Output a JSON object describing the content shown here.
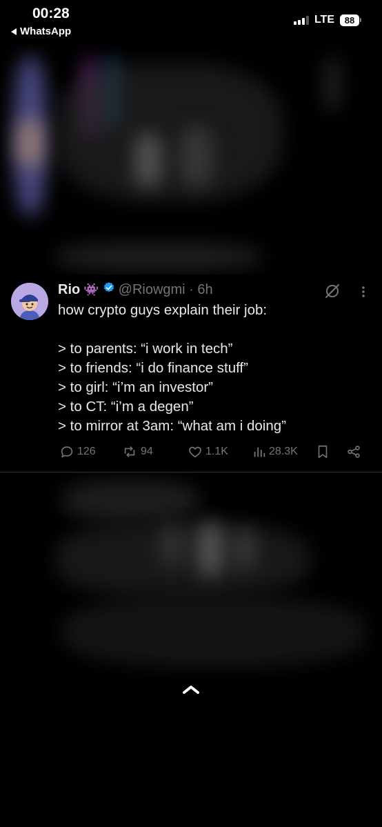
{
  "status_bar": {
    "time": "00:28",
    "back_app": "WhatsApp",
    "network": "LTE",
    "battery": "88"
  },
  "tweet": {
    "display_name": "Rio",
    "name_emoji": "👾",
    "handle_time": "@Riowgmi · 6h",
    "lines": [
      "how crypto guys explain their job:",
      "",
      "> to parents: “i work in tech”",
      "> to friends: “i do finance stuff”",
      "> to girl: “i’m an investor”",
      "> to CT: “i’m a degen”",
      "> to mirror at 3am: “what am i doing”"
    ],
    "stats": {
      "replies": "126",
      "reposts": "94",
      "likes": "1.1K",
      "views": "28.3K"
    }
  },
  "colors": {
    "background": "#000000",
    "text": "#e7e9ea",
    "muted": "#71767b",
    "verified": "#1d9bf0"
  }
}
